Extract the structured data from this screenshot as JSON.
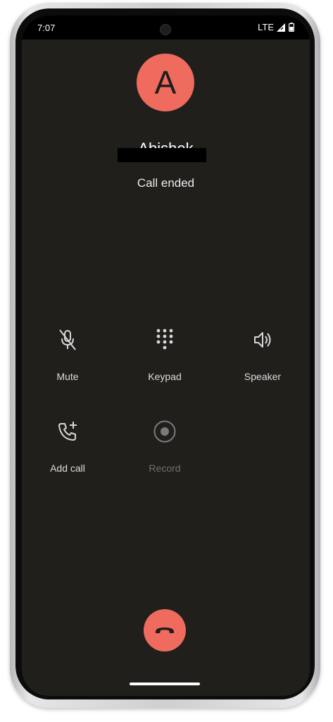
{
  "status_bar": {
    "time": "7:07",
    "network": "LTE"
  },
  "contact": {
    "initial": "A",
    "name": "Abishek"
  },
  "call": {
    "status": "Call ended"
  },
  "controls": [
    {
      "label": "Mute",
      "icon": "mic-off-icon",
      "enabled": true
    },
    {
      "label": "Keypad",
      "icon": "dialpad-icon",
      "enabled": true
    },
    {
      "label": "Speaker",
      "icon": "speaker-icon",
      "enabled": true
    },
    {
      "label": "Add call",
      "icon": "add-call-icon",
      "enabled": true
    },
    {
      "label": "Record",
      "icon": "record-icon",
      "enabled": false
    }
  ],
  "colors": {
    "accent": "#ee6b5e",
    "background": "#201f1c"
  }
}
